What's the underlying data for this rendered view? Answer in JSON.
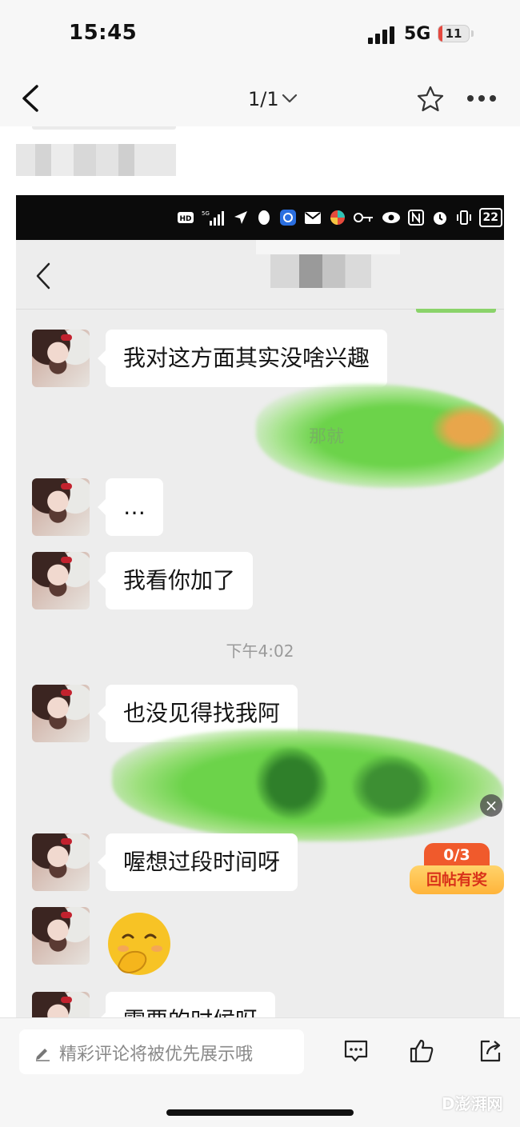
{
  "status_bar": {
    "time": "15:45",
    "network": "5G",
    "battery": "11"
  },
  "nav": {
    "pager": "1/1"
  },
  "screenshot": {
    "phone_battery": "22",
    "messages": [
      {
        "text": "我对这方面其实没啥兴趣"
      },
      {
        "text": "…"
      },
      {
        "text": "我看你加了"
      },
      {
        "text": "也没见得找我阿"
      },
      {
        "text": "喔想过段时间呀"
      },
      {
        "emoji": "smirk-hand-over-mouth"
      },
      {
        "text": "需要的时候呀"
      }
    ],
    "timestamp": "下午4:02",
    "scribble_text": "那就"
  },
  "overlay": {
    "close_symbol": "×",
    "reward_count": "0/3",
    "reward_label": "回帖有奖"
  },
  "bottom_bar": {
    "comment_placeholder": "精彩评论将被优先展示哦"
  },
  "watermark": "D澎湃网",
  "colors": {
    "accent_orange": "#f05a2c",
    "green_scribble": "#6cd34a"
  },
  "icons": [
    "back-icon",
    "chevron-down-icon",
    "star-icon",
    "more-icon",
    "pencil-icon",
    "comment-icon",
    "like-icon",
    "share-icon",
    "close-icon"
  ]
}
